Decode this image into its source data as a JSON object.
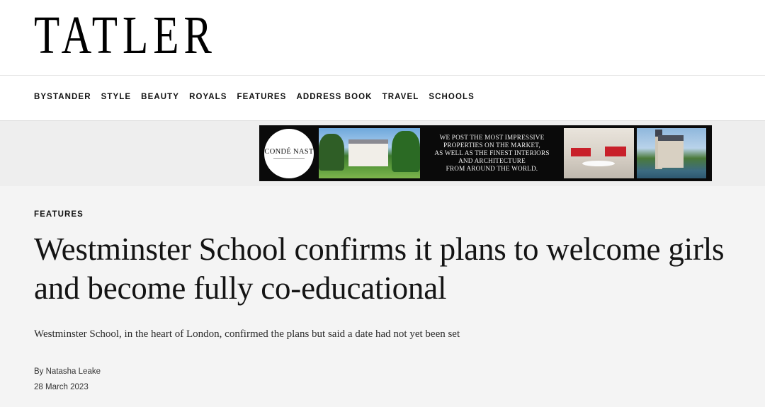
{
  "header": {
    "logo_text": "TATLER"
  },
  "nav": {
    "items": [
      {
        "label": "BYSTANDER"
      },
      {
        "label": "STYLE"
      },
      {
        "label": "BEAUTY"
      },
      {
        "label": "ROYALS"
      },
      {
        "label": "FEATURES"
      },
      {
        "label": "ADDRESS BOOK"
      },
      {
        "label": "TRAVEL"
      },
      {
        "label": "SCHOOLS"
      }
    ]
  },
  "ad": {
    "brand_logo_text": "CONDÉ NAST",
    "tagline": "WE POST THE MOST IMPRESSIVE\nPROPERTIES ON THE MARKET,\nAS WELL AS THE FINEST INTERIORS\nAND ARCHITECTURE\nFROM AROUND THE WORLD."
  },
  "article": {
    "category": "FEATURES",
    "headline": "Westminster School confirms it plans to welcome girls and become fully co-educational",
    "standfirst": "Westminster School, in the heart of London, confirmed the plans but said a date had not yet been set",
    "byline_prefix": "By",
    "author": "Natasha Leake",
    "date": "28 March 2023"
  }
}
